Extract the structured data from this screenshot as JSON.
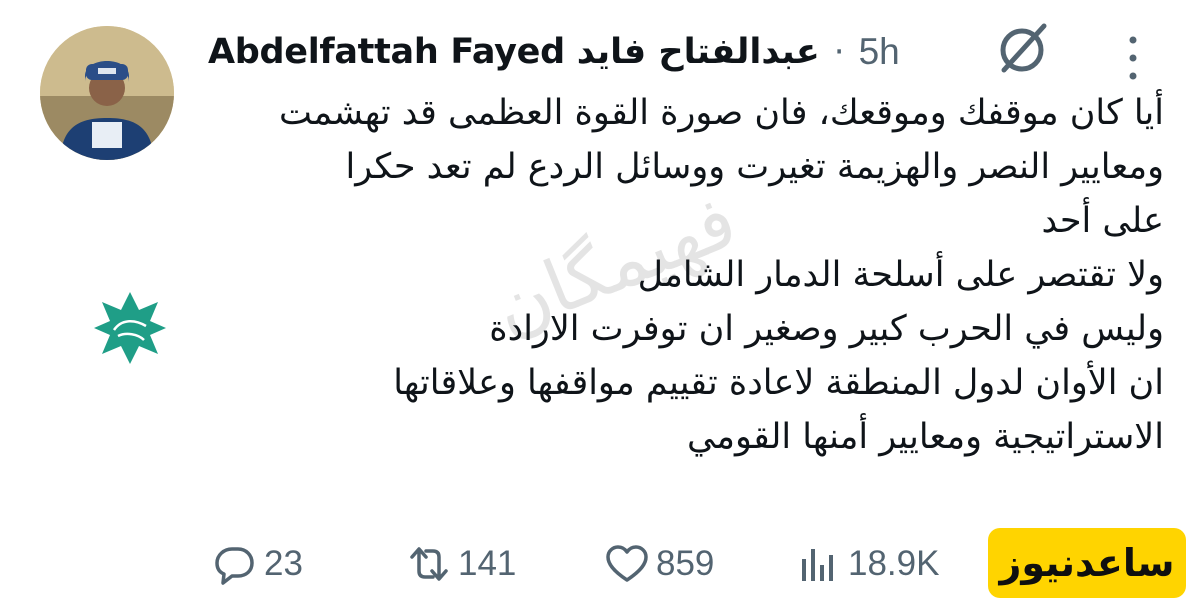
{
  "author": {
    "name": "Abdelfattah Fayed عبدالفتاح فايد",
    "separator": "·",
    "time": "5h"
  },
  "icons": {
    "brand": "grok-slash-circle-icon",
    "more": "more-vertical-icon",
    "reply": "reply-bubble-icon",
    "repost": "repost-arrows-icon",
    "like": "heart-icon",
    "views": "views-bars-icon"
  },
  "tweet": {
    "lines": [
      "أيا كان موقفك وموقعك، فان صورة القوة العظمى قد تهشمت",
      "ومعايير النصر والهزيمة تغيرت ووسائل الردع لم تعد حكرا",
      "على أحد",
      "ولا تقتصر على أسلحة الدمار الشامل",
      "وليس في الحرب كبير وصغير ان توفرت الارادة",
      "ان الأوان لدول المنطقة لاعادة تقييم مواقفها وعلاقاتها",
      "الاستراتيجية ومعايير أمنها القومي"
    ]
  },
  "watermark": "فهیمگان",
  "stats": {
    "replies": "23",
    "reposts": "141",
    "likes": "859",
    "views": "18.9K"
  },
  "badge": {
    "label": "ساعدنیوز",
    "color": "#ffd400"
  },
  "colors": {
    "text": "#0f1419",
    "muted": "#536471",
    "star_logo": "#1f9e87"
  }
}
